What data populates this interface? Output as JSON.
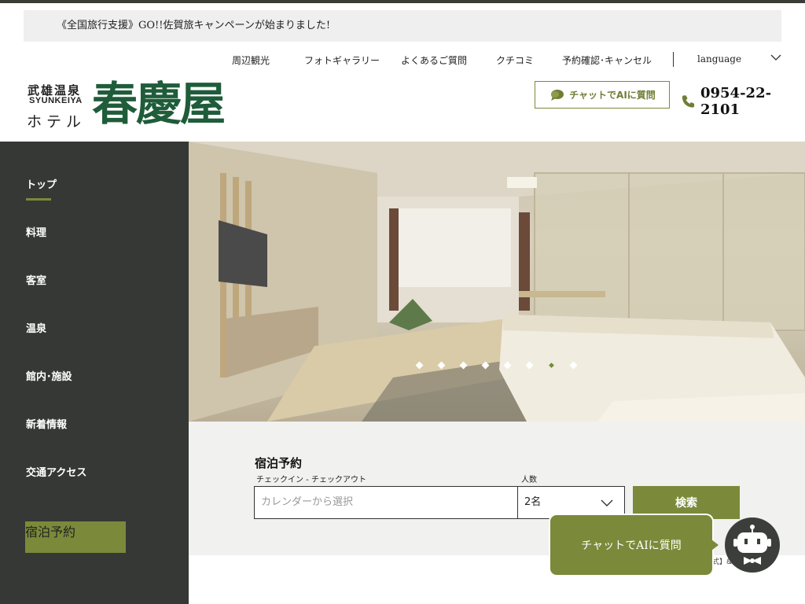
{
  "notice": {
    "text": "《全国旅行支援》GO!!佐賀旅キャンペーンが始まりました!"
  },
  "util_nav": {
    "links": [
      "周辺観光",
      "フォトギャラリー",
      "よくあるご質問",
      "クチコミ",
      "予約確認･キャンセル"
    ],
    "language_label": "language",
    "icons": {
      "language": "chevron-down-icon"
    }
  },
  "logo": {
    "region": "武雄温泉",
    "romaji": "SYUNKEIYA",
    "hotel": "ホテル",
    "brand": "春慶屋"
  },
  "header": {
    "chat_label": "チャットでAIに質問",
    "phone": "0954-22-2101",
    "icons": {
      "chat": "speech-bubble-icon",
      "phone": "phone-icon"
    }
  },
  "sidebar": {
    "items": [
      {
        "label": "トップ",
        "active": true
      },
      {
        "label": "料理"
      },
      {
        "label": "客室"
      },
      {
        "label": "温泉"
      },
      {
        "label": "館内･施設"
      },
      {
        "label": "新着情報"
      },
      {
        "label": "交通アクセス"
      }
    ],
    "reserve_label": "宿泊予約"
  },
  "hero": {
    "slide_count": 8,
    "active_slide": 7
  },
  "booking": {
    "title": "宿泊予約",
    "date_label": "チェックイン - チェックアウト",
    "date_placeholder": "カレンダーから選択",
    "people_label": "人数",
    "people_value": "2名",
    "search_label": "検索"
  },
  "footer_snippet": "式】&",
  "chat_widget": {
    "label": "チャットでAIに質問",
    "icon": "robot-icon"
  },
  "colors": {
    "accent": "#7a8a3a",
    "sidebar_bg": "#353835",
    "brand_green": "#1f5c3a"
  }
}
